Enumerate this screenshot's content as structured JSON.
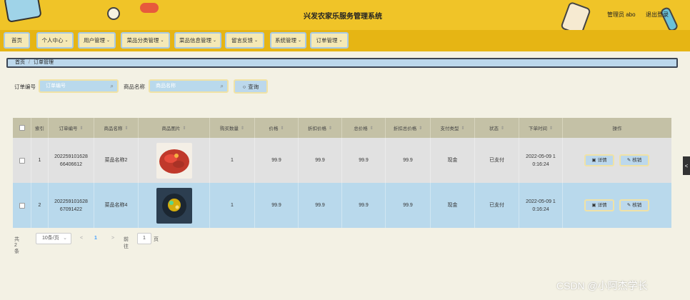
{
  "header": {
    "title": "兴发农家乐服务管理系统",
    "user_label": "管理员 abo",
    "logout_label": "退出登录"
  },
  "nav": {
    "items": [
      {
        "label": "首页",
        "has_menu": false
      },
      {
        "label": "个人中心",
        "has_menu": true
      },
      {
        "label": "用户管理",
        "has_menu": true
      },
      {
        "label": "菜品分类管理",
        "has_menu": true
      },
      {
        "label": "菜品信息管理",
        "has_menu": true
      },
      {
        "label": "留言反馈",
        "has_menu": true
      },
      {
        "label": "系统管理",
        "has_menu": true
      },
      {
        "label": "订单管理",
        "has_menu": true
      }
    ]
  },
  "breadcrumb": {
    "home": "首页",
    "sep": "/",
    "current": "订单管理"
  },
  "search": {
    "order_no_label": "订单编号",
    "order_no_placeholder": "订单编号",
    "dish_name_label": "商品名称",
    "dish_name_placeholder": "商品名称",
    "query_label": "查询"
  },
  "table": {
    "headers": [
      "索引",
      "订单编号",
      "商品名称",
      "商品图片",
      "购买数量",
      "价格",
      "折扣价格",
      "总价格",
      "折扣总价格",
      "支付类型",
      "状态",
      "下单时间",
      "操作"
    ],
    "rows": [
      {
        "index": "1",
        "order_no_1": "202259101628",
        "order_no_2": "66406612",
        "name": "菜品名称2",
        "image": "dish-red-icon",
        "qty": "1",
        "price": "99.9",
        "disc_price": "99.9",
        "total": "99.9",
        "disc_total": "99.9",
        "pay": "现金",
        "status": "已支付",
        "time_1": "2022-05-09 1",
        "time_2": "0:16:24"
      },
      {
        "index": "2",
        "order_no_1": "202259101628",
        "order_no_2": "67091422",
        "name": "菜品名称4",
        "image": "dish-dark-icon",
        "qty": "1",
        "price": "99.9",
        "disc_price": "99.9",
        "total": "99.9",
        "disc_total": "99.9",
        "pay": "现金",
        "status": "已支付",
        "time_1": "2022-05-09 1",
        "time_2": "0:16:24"
      }
    ],
    "detail_label": "详情",
    "verify_label": "核销"
  },
  "pager": {
    "total_label": "共 2 条",
    "page_size": "10条/页",
    "prev": "<",
    "current": "1",
    "next": ">",
    "goto_label": "前往",
    "goto_value": "1",
    "page_label": "页"
  },
  "side_tab": "<",
  "watermark": "CSDN @小阿杰学长",
  "colors": {
    "header_bg": "#f0c428",
    "nav_bg": "#e6b514",
    "nav_item_bg": "#f5e9b5",
    "row_alt_bg": "#b9d9ec",
    "row_bg": "#e1e1e1",
    "table_header_bg": "#c4c1a6",
    "page_bg": "#f3f1e4"
  }
}
